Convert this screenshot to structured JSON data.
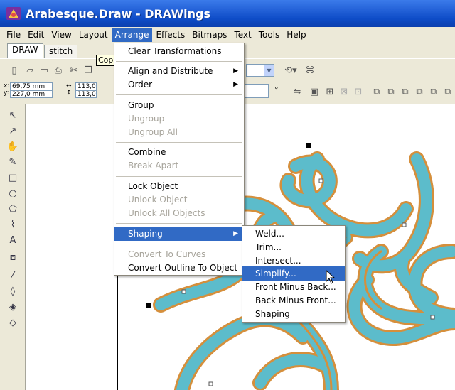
{
  "window": {
    "title": "Arabesque.Draw - DRAWings"
  },
  "menubar": {
    "items": [
      "File",
      "Edit",
      "View",
      "Layout",
      "Arrange",
      "Effects",
      "Bitmaps",
      "Text",
      "Tools",
      "Help"
    ],
    "active": "Arrange"
  },
  "tabs": [
    {
      "label": "DRAW",
      "selected": true
    },
    {
      "label": "stitch",
      "selected": false
    }
  ],
  "tooltip": {
    "text": "Cop"
  },
  "coordinates": {
    "x_label": "x:",
    "y_label": "y:",
    "x_value": "69,75 mm",
    "y_value": "227,0 mm",
    "w_value": "113,0",
    "h_value": "113,0"
  },
  "toolbar": {
    "degree_symbol": "°"
  },
  "arrange_menu": {
    "items": [
      {
        "label": "Clear Transformations",
        "enabled": true
      },
      {
        "label": "Align and Distribute",
        "enabled": true,
        "submenu": true
      },
      {
        "label": "Order",
        "enabled": true,
        "submenu": true
      },
      {
        "label": "Group",
        "enabled": true
      },
      {
        "label": "Ungroup",
        "enabled": false
      },
      {
        "label": "Ungroup All",
        "enabled": false
      },
      {
        "label": "Combine",
        "enabled": true
      },
      {
        "label": "Break Apart",
        "enabled": false
      },
      {
        "label": "Lock Object",
        "enabled": true
      },
      {
        "label": "Unlock Object",
        "enabled": false
      },
      {
        "label": "Unlock All Objects",
        "enabled": false
      },
      {
        "label": "Shaping",
        "enabled": true,
        "submenu": true,
        "highlighted": true
      },
      {
        "label": "Convert To Curves",
        "enabled": false
      },
      {
        "label": "Convert Outline To Object",
        "enabled": true
      }
    ]
  },
  "shaping_menu": {
    "items": [
      {
        "label": "Weld...",
        "highlighted": false
      },
      {
        "label": "Trim...",
        "highlighted": false
      },
      {
        "label": "Intersect...",
        "highlighted": false
      },
      {
        "label": "Simplify...",
        "highlighted": true
      },
      {
        "label": "Front Minus Back...",
        "highlighted": false
      },
      {
        "label": "Back Minus Front...",
        "highlighted": false
      },
      {
        "label": "Shaping",
        "highlighted": false
      }
    ]
  },
  "colors": {
    "titlebar": "#0e4cc7",
    "menu_highlight": "#316ac5",
    "ornament_fill": "#5cbccb",
    "ornament_outline": "#d58f3c",
    "chrome": "#ece9d8"
  },
  "icons": {
    "app": "drawings-app-icon",
    "tools": [
      "pointer-tool-icon",
      "shape-tool-icon",
      "pan-tool-icon",
      "freehand-tool-icon",
      "rectangle-tool-icon",
      "ellipse-tool-icon",
      "polygon-tool-icon",
      "curve-tool-icon",
      "text-tool-icon",
      "extrude-tool-icon",
      "eyedropper-tool-icon",
      "outline-tool-icon",
      "fill-tool-icon",
      "interactive-fill-tool-icon"
    ]
  }
}
